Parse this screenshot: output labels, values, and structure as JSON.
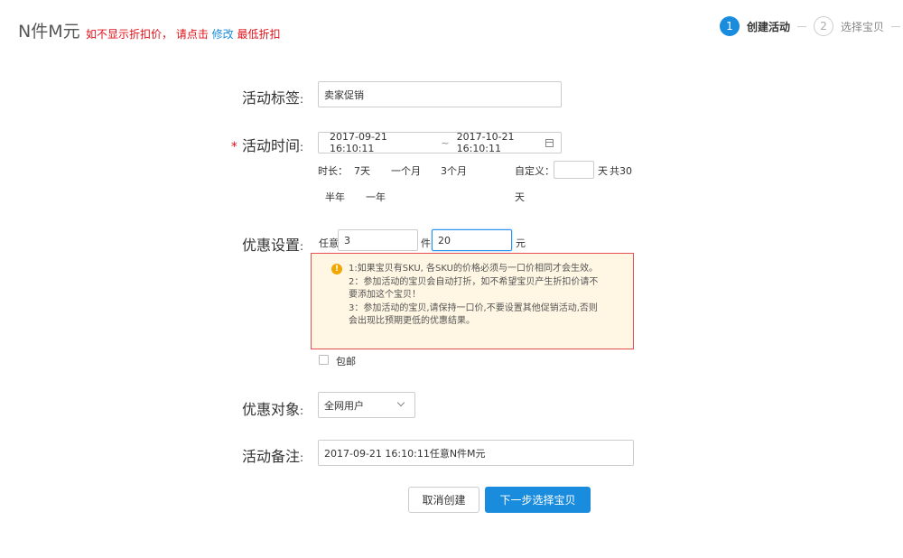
{
  "header": {
    "title": "N件M元",
    "notice_prefix": "如不显示折扣价， 请点击",
    "notice_link": "修改",
    "notice_suffix": "最低折扣"
  },
  "steps": [
    {
      "number": "1",
      "label": "创建活动"
    },
    {
      "number": "2",
      "label": "选择宝贝"
    }
  ],
  "form": {
    "tag": {
      "label": "活动标签",
      "colon": ":",
      "value": "卖家促销"
    },
    "time": {
      "required_mark": "*",
      "label": "活动时间",
      "colon": ":",
      "start": "2017-09-21 16:10:11",
      "separator": "~",
      "end": "2017-10-21 16:10:11",
      "duration_label": "时长：",
      "presets": [
        "7天",
        "一个月",
        "3个月",
        "半年",
        "一年"
      ],
      "custom_label": "自定义：",
      "custom_value": "",
      "custom_unit": "天",
      "total_text": "共30",
      "total_unit": "天"
    },
    "discount": {
      "label": "优惠设置",
      "colon": ":",
      "prefix": "任意",
      "quantity": "3",
      "quantity_unit": "件",
      "price": "20",
      "price_unit": "元",
      "warnings": [
        "1:如果宝贝有SKU, 各SKU的价格必须与一口价相同才会生效。",
        "2：参加活动的宝贝会自动打折，如不希望宝贝产生折扣价请不要添加这个宝贝！",
        "3：参加活动的宝贝,请保持一口价,不要设置其他促销活动,否则会出现比预期更低的优惠结果。"
      ],
      "free_shipping_label": "包邮"
    },
    "target": {
      "label": "优惠对象",
      "colon": ":",
      "selected": "全网用户"
    },
    "remark": {
      "label": "活动备注",
      "colon": ":",
      "value": "2017-09-21 16:10:11任意N件M元"
    }
  },
  "buttons": {
    "cancel": "取消创建",
    "next": "下一步选择宝贝"
  },
  "colors": {
    "accent": "#1a8cde",
    "warning": "#e0101a",
    "warn_bg": "#fff6e3"
  }
}
